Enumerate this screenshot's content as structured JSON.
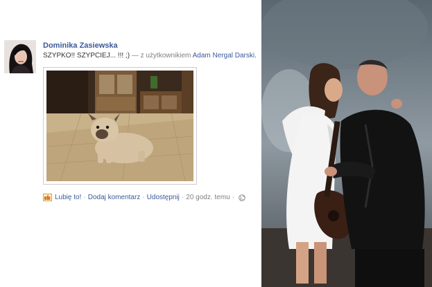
{
  "post": {
    "author": "Dominika Zasiewska",
    "message": "SZYPKO!! SZYPCIEJ... !!! ;)",
    "with_prefix": "— z użytkownikiem",
    "tagged_user": "Adam Nergal Darski.",
    "actions": {
      "like": "Lubię to!",
      "comment": "Dodaj komentarz",
      "share": "Udostępnij",
      "timestamp": "20 godz. temu"
    },
    "separator": "·"
  },
  "icons": {
    "like": "thumbs-up-icon",
    "privacy": "globe-icon"
  },
  "colors": {
    "link": "#3b5998",
    "meta": "#808080",
    "text": "#333333"
  }
}
